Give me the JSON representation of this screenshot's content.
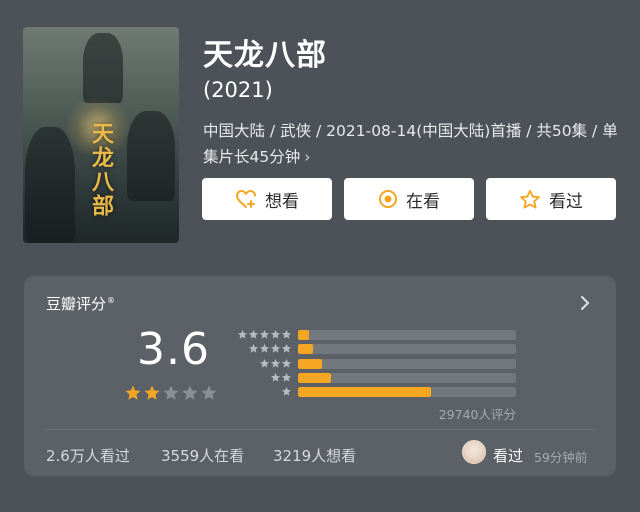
{
  "movie": {
    "title": "天龙八部",
    "year": "(2021)",
    "meta": "中国大陆 / 武侠 / 2021-08-14(中国大陆)首播 / 共50集 / 单集片长45分钟",
    "poster_title": "天龙八部"
  },
  "actions": {
    "want": "想看",
    "watching": "在看",
    "watched": "看过"
  },
  "rating": {
    "label": "豆瓣评分",
    "mark": "®",
    "score": "3.6",
    "stars_filled": 2,
    "stars_total": 5,
    "votes": "29740人评分",
    "distribution": [
      {
        "stars": 5,
        "fraction": 0.05
      },
      {
        "stars": 4,
        "fraction": 0.07
      },
      {
        "stars": 3,
        "fraction": 0.11
      },
      {
        "stars": 2,
        "fraction": 0.15
      },
      {
        "stars": 1,
        "fraction": 0.61
      }
    ]
  },
  "stats": {
    "watched": "2.6万人看过",
    "watching": "3559人在看",
    "want": "3219人想看"
  },
  "user": {
    "status": "看过",
    "time": "59分钟前"
  },
  "colors": {
    "background": "#4d5258",
    "card": "#5c6167",
    "accent": "#f5a623",
    "button_icon": "#f5a623"
  }
}
